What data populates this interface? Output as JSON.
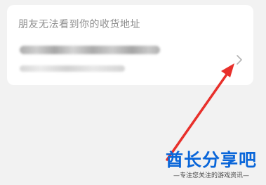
{
  "address_card": {
    "notice": "朋友无法看到你的收货地址",
    "chevron_icon": "chevron-right-icon"
  },
  "annotation": {
    "arrow_color": "#e8302b",
    "icon": "red-arrow-icon"
  },
  "watermark": {
    "title": "酋长分享吧",
    "subtitle": "—专注您关注的游戏资讯—",
    "color": "#0a66d9"
  }
}
